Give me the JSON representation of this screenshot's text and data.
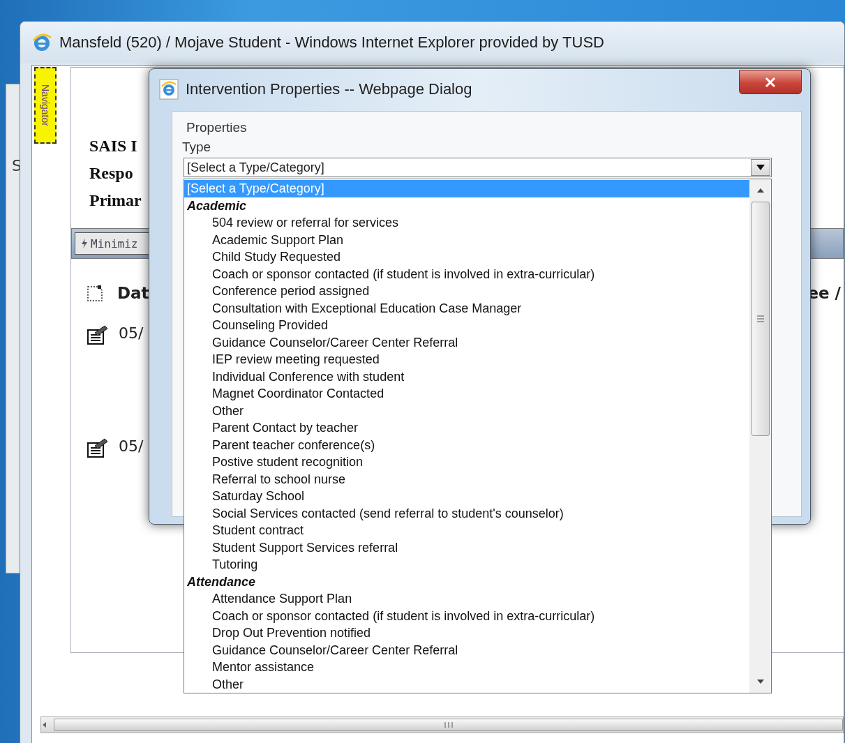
{
  "back_window": {
    "text": "S"
  },
  "window": {
    "title": "Mansfeld (520) / Mojave Student - Windows Internet Explorer provided by TUSD"
  },
  "navigator": {
    "label": "Navigator"
  },
  "student_fields": [
    "SAIS I",
    "Respo",
    "Primar"
  ],
  "minimize_button": "Minimiz",
  "table": {
    "columns": [
      "Dat",
      "ee /"
    ],
    "rows": [
      {
        "column_1": "05/"
      },
      {
        "column_1": "05/"
      }
    ]
  },
  "dialog": {
    "title": "Intervention Properties -- Webpage Dialog",
    "section": "Properties",
    "type_label": "Type",
    "select_value": "[Select a Type/Category]",
    "options": [
      {
        "kind": "option",
        "label": "[Select a Type/Category]",
        "selected": true
      },
      {
        "kind": "group",
        "label": "Academic",
        "children": [
          {
            "kind": "option",
            "label": "504 review or referral for services",
            "selected": false
          },
          {
            "kind": "option",
            "label": "Academic Support Plan",
            "selected": false
          },
          {
            "kind": "option",
            "label": "Child Study Requested",
            "selected": false
          },
          {
            "kind": "option",
            "label": "Coach or sponsor contacted (if student is involved in extra-curricular)",
            "selected": false
          },
          {
            "kind": "option",
            "label": "Conference period assigned",
            "selected": false
          },
          {
            "kind": "option",
            "label": "Consultation with Exceptional Education Case Manager",
            "selected": false
          },
          {
            "kind": "option",
            "label": "Counseling Provided",
            "selected": false
          },
          {
            "kind": "option",
            "label": "Guidance Counselor/Career Center Referral",
            "selected": false
          },
          {
            "kind": "option",
            "label": "IEP review meeting requested",
            "selected": false
          },
          {
            "kind": "option",
            "label": "Individual Conference with student",
            "selected": false
          },
          {
            "kind": "option",
            "label": "Magnet Coordinator Contacted",
            "selected": false
          },
          {
            "kind": "option",
            "label": "Other",
            "selected": false
          },
          {
            "kind": "option",
            "label": "Parent Contact by teacher",
            "selected": false
          },
          {
            "kind": "option",
            "label": "Parent teacher conference(s)",
            "selected": false
          },
          {
            "kind": "option",
            "label": "Postive student recognition",
            "selected": false
          },
          {
            "kind": "option",
            "label": "Referral to school nurse",
            "selected": false
          },
          {
            "kind": "option",
            "label": "Saturday School",
            "selected": false
          },
          {
            "kind": "option",
            "label": "Social Services contacted (send referral to student's counselor)",
            "selected": false
          },
          {
            "kind": "option",
            "label": "Student contract",
            "selected": false
          },
          {
            "kind": "option",
            "label": "Student Support Services referral",
            "selected": false
          },
          {
            "kind": "option",
            "label": "Tutoring",
            "selected": false
          }
        ]
      },
      {
        "kind": "group",
        "label": "Attendance",
        "children": [
          {
            "kind": "option",
            "label": "Attendance Support Plan",
            "selected": false
          },
          {
            "kind": "option",
            "label": "Coach or sponsor contacted (if student is involved in extra-curricular)",
            "selected": false
          },
          {
            "kind": "option",
            "label": "Drop Out Prevention notified",
            "selected": false
          },
          {
            "kind": "option",
            "label": "Guidance Counselor/Career Center Referral",
            "selected": false
          },
          {
            "kind": "option",
            "label": "Mentor assistance",
            "selected": false
          },
          {
            "kind": "option",
            "label": "Other",
            "selected": false
          }
        ]
      }
    ]
  }
}
